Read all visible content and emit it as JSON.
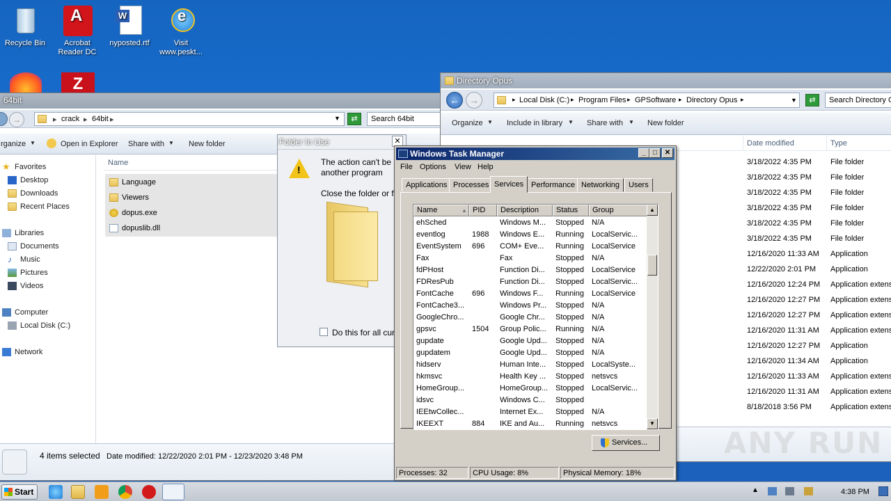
{
  "desktop": {
    "icons": [
      {
        "label": "Recycle Bin"
      },
      {
        "label": "Acrobat Reader DC"
      },
      {
        "label": "nyposted.rtf"
      },
      {
        "label": "Visit www.peskt..."
      }
    ]
  },
  "explorer_left": {
    "title": "64bit",
    "breadcrumb": [
      "crack",
      "64bit"
    ],
    "search_placeholder": "Search 64bit",
    "toolbar": {
      "organize": "rganize",
      "open_in_explorer": "Open in Explorer",
      "share_with": "Share with",
      "new_folder": "New folder"
    },
    "nav": {
      "favorites": "Favorites",
      "desktop": "Desktop",
      "downloads": "Downloads",
      "recent": "Recent Places",
      "libraries": "Libraries",
      "documents": "Documents",
      "music": "Music",
      "pictures": "Pictures",
      "videos": "Videos",
      "computer": "Computer",
      "local_disk": "Local Disk (C:)",
      "network": "Network"
    },
    "column_name": "Name",
    "files": [
      {
        "name": "Language",
        "icon": "folder-icon"
      },
      {
        "name": "Viewers",
        "icon": "folder-icon"
      },
      {
        "name": "dopus.exe",
        "icon": "exe-icon"
      },
      {
        "name": "dopuslib.dll",
        "icon": "dll-icon"
      }
    ],
    "details": {
      "selected": "4 items selected",
      "date_modified": "Date modified: 12/22/2020 2:01 PM - 12/23/2020 3:48 PM"
    }
  },
  "explorer_right": {
    "title": "Directory Opus",
    "breadcrumb": [
      "Local Disk (C:)",
      "Program Files",
      "GPSoftware",
      "Directory Opus"
    ],
    "search_placeholder": "Search Directory O",
    "toolbar": {
      "organize": "Organize",
      "include": "Include in library",
      "share_with": "Share with",
      "new_folder": "New folder"
    },
    "columns": {
      "date_modified": "Date modified",
      "type": "Type"
    },
    "rows": [
      {
        "date": "3/18/2022 4:35 PM",
        "type": "File folder"
      },
      {
        "date": "3/18/2022 4:35 PM",
        "type": "File folder"
      },
      {
        "date": "3/18/2022 4:35 PM",
        "type": "File folder"
      },
      {
        "date": "3/18/2022 4:35 PM",
        "type": "File folder"
      },
      {
        "date": "3/18/2022 4:35 PM",
        "type": "File folder"
      },
      {
        "date": "3/18/2022 4:35 PM",
        "type": "File folder"
      },
      {
        "date": "12/16/2020 11:33 AM",
        "type": "Application"
      },
      {
        "date": "12/22/2020 2:01 PM",
        "type": "Application"
      },
      {
        "date": "12/16/2020 12:24 PM",
        "type": "Application extens"
      },
      {
        "date": "12/16/2020 12:27 PM",
        "type": "Application extens"
      },
      {
        "date": "12/16/2020 12:27 PM",
        "type": "Application extens"
      },
      {
        "date": "12/16/2020 11:31 AM",
        "type": "Application extens"
      },
      {
        "date": "12/16/2020 12:27 PM",
        "type": "Application"
      },
      {
        "date": "12/16/2020 11:34 AM",
        "type": "Application"
      },
      {
        "date": "12/16/2020 11:33 AM",
        "type": "Application extens"
      },
      {
        "date": "12/16/2020 11:31 AM",
        "type": "Application extens"
      },
      {
        "date": "8/18/2018 3:56 PM",
        "type": "Application extens"
      }
    ]
  },
  "folder_in_use": {
    "title": "Folder In Use",
    "message_line1": "The action can't be",
    "message_line2": "another program",
    "message_line3": "Close the folder or f",
    "checkbox": "Do this for all cur"
  },
  "task_manager": {
    "title": "Windows Task Manager",
    "menu": [
      "File",
      "Options",
      "View",
      "Help"
    ],
    "tabs": [
      "Applications",
      "Processes",
      "Services",
      "Performance",
      "Networking",
      "Users"
    ],
    "active_tab": "Services",
    "columns": [
      "Name",
      "PID",
      "Description",
      "Status",
      "Group"
    ],
    "services": [
      {
        "name": "ehSched",
        "pid": "",
        "desc": "Windows M...",
        "status": "Stopped",
        "group": "N/A"
      },
      {
        "name": "eventlog",
        "pid": "1988",
        "desc": "Windows E...",
        "status": "Running",
        "group": "LocalServic..."
      },
      {
        "name": "EventSystem",
        "pid": "696",
        "desc": "COM+ Eve...",
        "status": "Running",
        "group": "LocalService"
      },
      {
        "name": "Fax",
        "pid": "",
        "desc": "Fax",
        "status": "Stopped",
        "group": "N/A"
      },
      {
        "name": "fdPHost",
        "pid": "",
        "desc": "Function Di...",
        "status": "Stopped",
        "group": "LocalService"
      },
      {
        "name": "FDResPub",
        "pid": "",
        "desc": "Function Di...",
        "status": "Stopped",
        "group": "LocalServic..."
      },
      {
        "name": "FontCache",
        "pid": "696",
        "desc": "Windows F...",
        "status": "Running",
        "group": "LocalService"
      },
      {
        "name": "FontCache3...",
        "pid": "",
        "desc": "Windows Pr...",
        "status": "Stopped",
        "group": "N/A"
      },
      {
        "name": "GoogleChro...",
        "pid": "",
        "desc": "Google Chr...",
        "status": "Stopped",
        "group": "N/A"
      },
      {
        "name": "gpsvc",
        "pid": "1504",
        "desc": "Group Polic...",
        "status": "Running",
        "group": "N/A"
      },
      {
        "name": "gupdate",
        "pid": "",
        "desc": "Google Upd...",
        "status": "Stopped",
        "group": "N/A"
      },
      {
        "name": "gupdatem",
        "pid": "",
        "desc": "Google Upd...",
        "status": "Stopped",
        "group": "N/A"
      },
      {
        "name": "hidserv",
        "pid": "",
        "desc": "Human Inte...",
        "status": "Stopped",
        "group": "LocalSyste..."
      },
      {
        "name": "hkmsvc",
        "pid": "",
        "desc": "Health Key ...",
        "status": "Stopped",
        "group": "netsvcs"
      },
      {
        "name": "HomeGroup...",
        "pid": "",
        "desc": "HomeGroup...",
        "status": "Stopped",
        "group": "LocalServic..."
      },
      {
        "name": "idsvc",
        "pid": "",
        "desc": "Windows C...",
        "status": "Stopped",
        "group": ""
      },
      {
        "name": "IEEtwCollec...",
        "pid": "",
        "desc": "Internet Ex...",
        "status": "Stopped",
        "group": "N/A"
      },
      {
        "name": "IKEEXT",
        "pid": "884",
        "desc": "IKE and Au...",
        "status": "Running",
        "group": "netsvcs"
      }
    ],
    "services_button": "Services...",
    "status": {
      "processes": "Processes: 32",
      "cpu": "CPU Usage: 8%",
      "memory": "Physical Memory: 18%"
    }
  },
  "taskbar": {
    "start": "Start",
    "clock": "4:38 PM"
  },
  "watermark": "ANY RUN"
}
